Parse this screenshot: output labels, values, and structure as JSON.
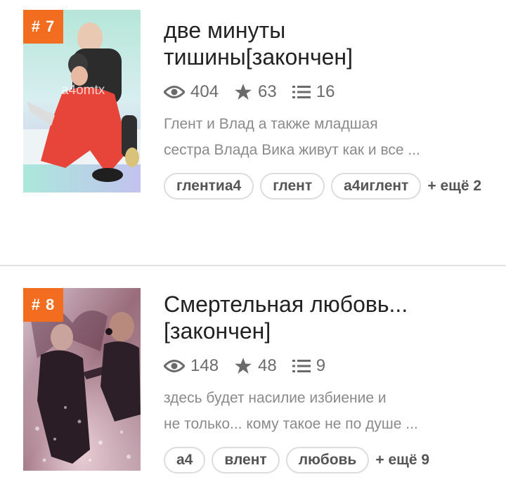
{
  "stories": [
    {
      "rank": "# 7",
      "watermark": "a4omtx",
      "title_line1": "две минуты",
      "title_line2": "тишины[закончен]",
      "views": "404",
      "stars": "63",
      "chapters": "16",
      "desc_line1": "Глент и Влад а также младшая",
      "desc_line2": "сестра Влада Вика живут как и все ...",
      "tags": [
        "глентиа4",
        "глент",
        "а4иглент"
      ],
      "more": "+ ещё 2"
    },
    {
      "rank": "# 8",
      "title_line1": "Смертельная любовь...",
      "title_line2": "[закончен]",
      "views": "148",
      "stars": "48",
      "chapters": "9",
      "desc_line1": "здесь будет насилие избиение и",
      "desc_line2": "не только... кому такое не по душе ...",
      "tags": [
        "а4",
        "влент",
        "любовь"
      ],
      "more": "+ ещё 9"
    }
  ],
  "colors": {
    "rank_badge": "#f26d1f",
    "title": "#222222",
    "stats": "#6b6b6b",
    "description": "#8a8a8a",
    "tag_border": "#dddddd"
  },
  "icons": {
    "views": "eye-icon",
    "stars": "star-icon",
    "chapters": "list-icon"
  }
}
